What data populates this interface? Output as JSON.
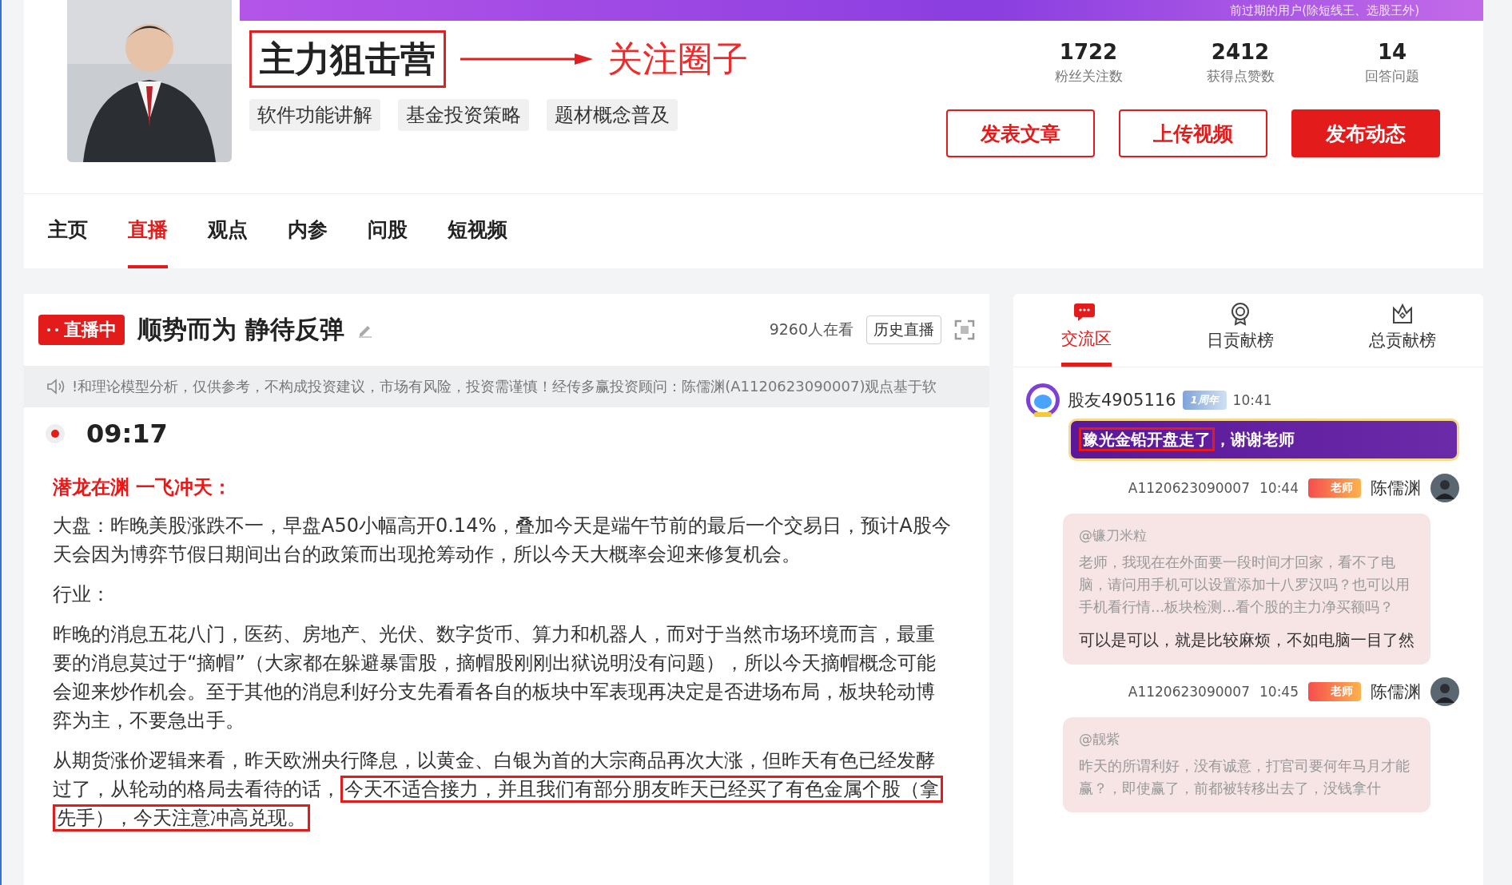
{
  "banner": {
    "text": "前过期的用户(除短线王、选股王外)"
  },
  "profile": {
    "name": "主力狙击营",
    "annotation": "关注圈子",
    "tags": [
      "软件功能讲解",
      "基金投资策略",
      "题材概念普及"
    ],
    "stats": [
      {
        "value": "1722",
        "label": "粉丝关注数"
      },
      {
        "value": "2412",
        "label": "获得点赞数"
      },
      {
        "value": "14",
        "label": "回答问题"
      }
    ],
    "buttons": [
      {
        "label": "发表文章",
        "kind": "outline"
      },
      {
        "label": "上传视频",
        "kind": "outline"
      },
      {
        "label": "发布动态",
        "kind": "filled"
      }
    ]
  },
  "nav_tabs": [
    {
      "label": "主页",
      "selected": false
    },
    {
      "label": "直播",
      "selected": true
    },
    {
      "label": "观点",
      "selected": false
    },
    {
      "label": "内参",
      "selected": false
    },
    {
      "label": "问股",
      "selected": false
    },
    {
      "label": "短视频",
      "selected": false
    }
  ],
  "live": {
    "badge": "直播中",
    "title": "顺势而为 静待反弹",
    "viewers": "9260人在看",
    "history_button": "历史直播",
    "notice": "!和理论模型分析，仅供参考，不构成投资建议，市场有风险，投资需谨慎！经传多赢投资顾问：陈儒渊(A1120623090007)观点基于软",
    "time": "09:17",
    "heading": "潜龙在渊 一飞冲天：",
    "paragraphs": [
      [
        {
          "text": "大盘：昨晚美股涨跌不一，早盘A50小幅高开0.14%，叠加今天是端午节前的最后一个交易日，预计A股今天会因为博弈节假日期间出台的政策而出现抢筹动作，所以今天大概率会迎来修复机会。",
          "highlighted": false
        }
      ],
      [
        {
          "text": "行业：",
          "highlighted": false
        }
      ],
      [
        {
          "text": "昨晚的消息五花八门，医药、房地产、光伏、数字货币、算力和机器人，而对于当然市场环境而言，最重要的消息莫过于“摘帽”（大家都在躲避暴雷股，摘帽股刚刚出狱说明没有问题），所以今天摘帽概念可能会迎来炒作机会。至于其他的消息利好分支先看看各自的板块中军表现再决定是否进场布局，板块轮动博弈为主，不要急出手。",
          "highlighted": false
        }
      ],
      [
        {
          "text": "从期货涨价逻辑来看，昨天欧洲央行降息，以黄金、白银为首的大宗商品再次大涨，但昨天有色已经发酵过了，从轮动的格局去看待的话，",
          "highlighted": false
        },
        {
          "text": "今天不适合接力，并且我们有部分朋友昨天已经买了有色金属个股（拿先手），今天注意冲高兑现。",
          "highlighted": true
        }
      ]
    ]
  },
  "chat": {
    "tabs": [
      {
        "label": "交流区",
        "selected": true
      },
      {
        "label": "日贡献榜",
        "selected": false
      },
      {
        "label": "总贡献榜",
        "selected": false
      }
    ],
    "messages": [
      {
        "kind": "user",
        "name": "股友4905116",
        "badge": "1周年",
        "time": "10:41",
        "segments": [
          {
            "text": "豫光金铅开盘走了",
            "highlighted": true
          },
          {
            "text": "，谢谢老师",
            "highlighted": false
          }
        ]
      },
      {
        "kind": "teacher",
        "id": "A1120623090007",
        "time": "10:44",
        "badge": "老师",
        "name": "陈儒渊",
        "quote_user": "@镰刀米粒",
        "quote": "老师，我现在在外面要一段时间才回家，看不了电脑，请问用手机可以设置添加十八罗汉吗？也可以用手机看行情...板块检测...看个股的主力净买额吗？",
        "reply": "可以是可以，就是比较麻烦，不如电脑一目了然"
      },
      {
        "kind": "teacher",
        "id": "A1120623090007",
        "time": "10:45",
        "badge": "老师",
        "name": "陈儒渊",
        "quote_user": "@靓紫",
        "quote": "昨天的所谓利好，没有诚意，打官司要何年马月才能赢？，即使赢了，前都被转移出去了，没钱拿什"
      }
    ]
  }
}
